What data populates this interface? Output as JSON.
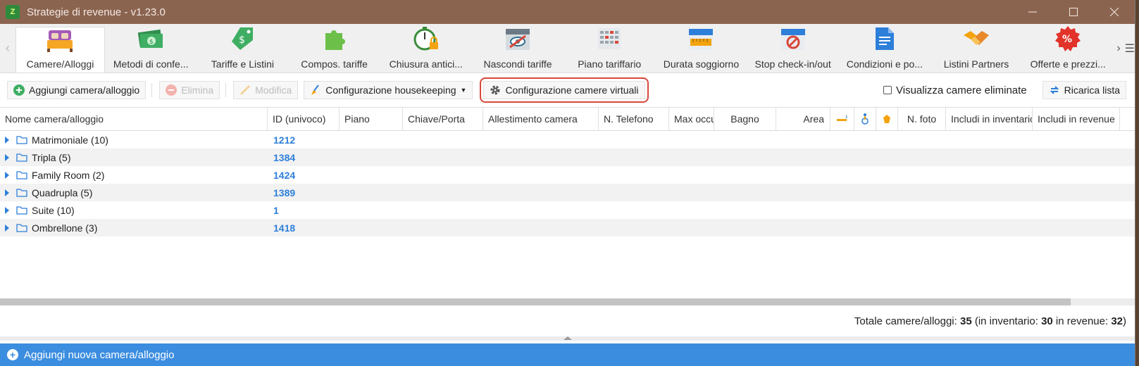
{
  "window": {
    "title": "Strategie di revenue - v1.23.0",
    "app_icon_text": "Z"
  },
  "ribbon": {
    "tabs": [
      {
        "label": "Camere/Alloggi",
        "icon": "bed-icon",
        "active": true
      },
      {
        "label": "Metodi di confe...",
        "icon": "money-icon"
      },
      {
        "label": "Tariffe e Listini",
        "icon": "price-tag-icon"
      },
      {
        "label": "Compos. tariffe",
        "icon": "puzzle-icon"
      },
      {
        "label": "Chiusura antici...",
        "icon": "timer-lock-icon"
      },
      {
        "label": "Nascondi tariffe",
        "icon": "hidden-calendar-icon"
      },
      {
        "label": "Piano tariffario",
        "icon": "grid-calendar-icon"
      },
      {
        "label": "Durata soggiorno",
        "icon": "ruler-calendar-icon"
      },
      {
        "label": "Stop check-in/out",
        "icon": "stop-calendar-icon"
      },
      {
        "label": "Condizioni e po...",
        "icon": "document-icon"
      },
      {
        "label": "Listini Partners",
        "icon": "handshake-icon"
      },
      {
        "label": "Offerte e prezzi...",
        "icon": "discount-badge-icon"
      }
    ]
  },
  "toolbar": {
    "add_label": "Aggiungi camera/alloggio",
    "delete_label": "Elimina",
    "edit_label": "Modifica",
    "housekeeping_label": "Configurazione housekeeping",
    "virtual_rooms_label": "Configurazione camere virtuali",
    "show_deleted_label": "Visualizza camere eliminate",
    "reload_label": "Ricarica lista"
  },
  "grid": {
    "columns": [
      "Nome camera/alloggio",
      "ID (univoco)",
      "Piano",
      "Chiave/Porta",
      "Allestimento camera",
      "N. Telefono",
      "Max occu",
      "Bagno",
      "Area",
      "",
      "",
      "",
      "N. foto",
      "Includi in inventario",
      "Includi in revenue"
    ],
    "rows": [
      {
        "name": "Matrimoniale (10)",
        "id": "1212"
      },
      {
        "name": "Tripla (5)",
        "id": "1384"
      },
      {
        "name": "Family Room (2)",
        "id": "1424"
      },
      {
        "name": "Quadrupla (5)",
        "id": "1389"
      },
      {
        "name": "Suite (10)",
        "id": "1"
      },
      {
        "name": "Ombrellone (3)",
        "id": "1418"
      }
    ]
  },
  "totals": {
    "prefix": "Totale camere/alloggi:",
    "total": "35",
    "inv_prefix": "(in inventario:",
    "inventory": "30",
    "rev_prefix": "in revenue:",
    "revenue": "32",
    "suffix": ")"
  },
  "bottom_bar": {
    "label": "Aggiungi nuova camera/alloggio"
  }
}
